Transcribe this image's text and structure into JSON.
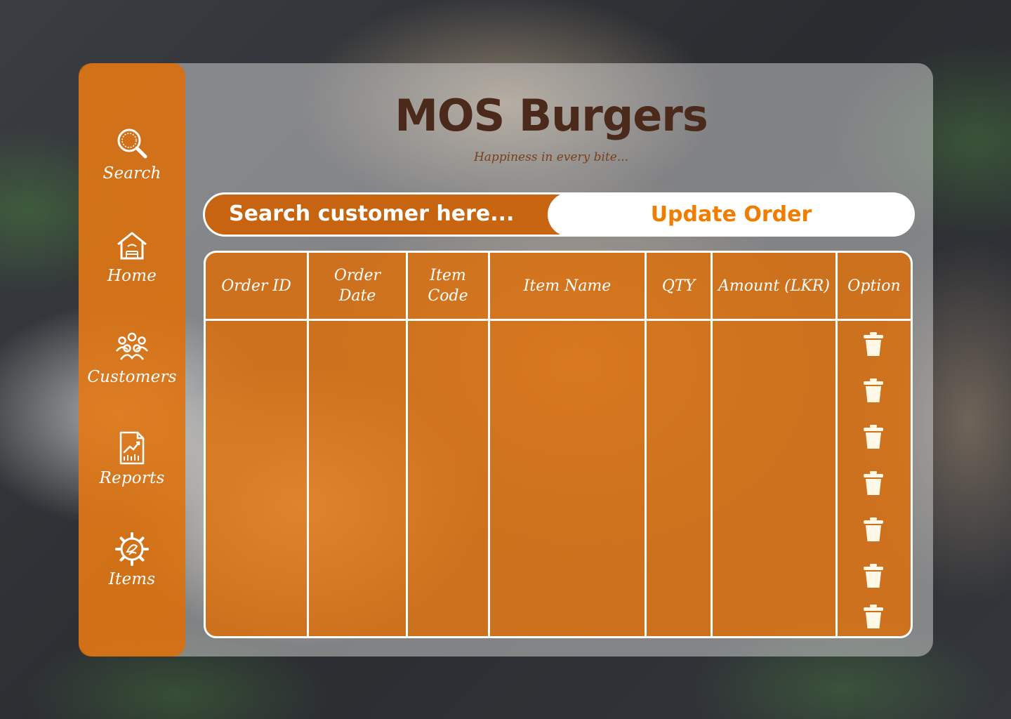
{
  "brand": {
    "title": "MOS Burgers",
    "tagline": "Happiness in every bite..."
  },
  "sidebar": {
    "items": [
      {
        "label": "Search",
        "icon": "magnifier-icon"
      },
      {
        "label": "Home",
        "icon": "home-icon"
      },
      {
        "label": "Customers",
        "icon": "customers-icon"
      },
      {
        "label": "Reports",
        "icon": "report-icon"
      },
      {
        "label": "Items",
        "icon": "items-gear-icon"
      }
    ]
  },
  "search": {
    "placeholder": "Search customer here..."
  },
  "actions": {
    "update_label": "Update Order"
  },
  "table": {
    "columns": [
      "Order ID",
      "Order Date",
      "Item Code",
      "Item Name",
      "QTY",
      "Amount (LKR)",
      "Option"
    ],
    "delete_icon": "trash-icon",
    "rows": 7
  },
  "colors": {
    "accent": "#e26c00",
    "update_text": "#f07d00",
    "brand_text": "#4b2a1c",
    "tagline_text": "#7a3f1a"
  }
}
